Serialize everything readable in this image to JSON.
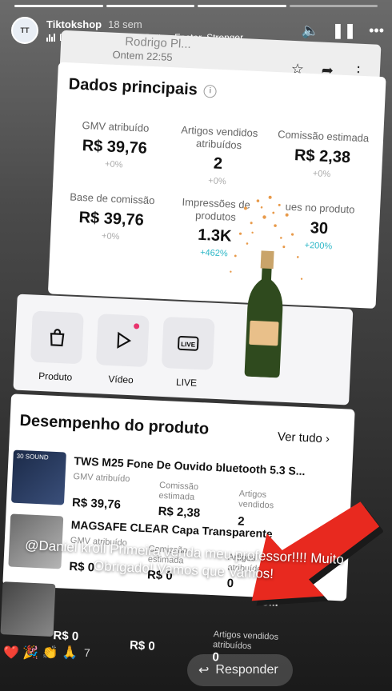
{
  "story": {
    "username": "Tiktokshop",
    "time": "18 sem",
    "music": "Daft Punk · Harder, Better, Faster, Stronger"
  },
  "screenshot": {
    "contact_name": "Rodrigo Pl...",
    "contact_time": "Ontem 22:55",
    "main": {
      "title": "Dados principais",
      "metrics": [
        {
          "label": "GMV atribuído",
          "value": "R$ 39,76",
          "change": "+0%"
        },
        {
          "label": "Artigos vendidos atribuídos",
          "value": "2",
          "change": "+0%"
        },
        {
          "label": "Comissão estimada",
          "value": "R$ 2,38",
          "change": "+0%"
        },
        {
          "label": "Base de comissão",
          "value": "R$ 39,76",
          "change": "+0%"
        },
        {
          "label": "Impressões de produtos",
          "value": "1.3K",
          "change": "+462%"
        },
        {
          "label": "ues no produto",
          "value": "30",
          "change": "+200%"
        }
      ]
    },
    "shortcuts": [
      {
        "label": "Produto"
      },
      {
        "label": "Vídeo"
      },
      {
        "label": "LIVE"
      }
    ],
    "performance": {
      "title": "Desempenho do produto",
      "see_all": "Ver tudo",
      "products": [
        {
          "name": "TWS M25 Fone De Ouvido bluetooth 5.3 S...",
          "gmv_label": "GMV atribuído",
          "gmv": "R$ 39,76",
          "comm_label": "Comissão estimada",
          "comm": "R$ 2,38",
          "sold_label": "Artigos vendidos",
          "sold": "2",
          "thumb_text": "30 SOUND"
        },
        {
          "name": "MAGSAFE CLEAR Capa Transparente",
          "gmv_label": "GMV atribuído",
          "gmv": "R$ 0",
          "comm_label": "Comissão estimada",
          "comm": "R$ 0",
          "sold_label": "Artigos atribuídos",
          "sold": "0"
        },
        {
          "name": "S...",
          "gmv_label": "",
          "gmv": "R$ 0",
          "comm_label": "",
          "comm": "R$ 0",
          "sold_label": "Artigos vendidos atribuídos",
          "sold": "0"
        }
      ]
    }
  },
  "caption": "@Daniel kroll Primeira venda meu professor!!!! Muito Obrigado! Vamos que Vamos!",
  "reactions": {
    "emojis": "❤️ 🎉 👏 🙏",
    "count": "7"
  },
  "reply_label": "Responder"
}
